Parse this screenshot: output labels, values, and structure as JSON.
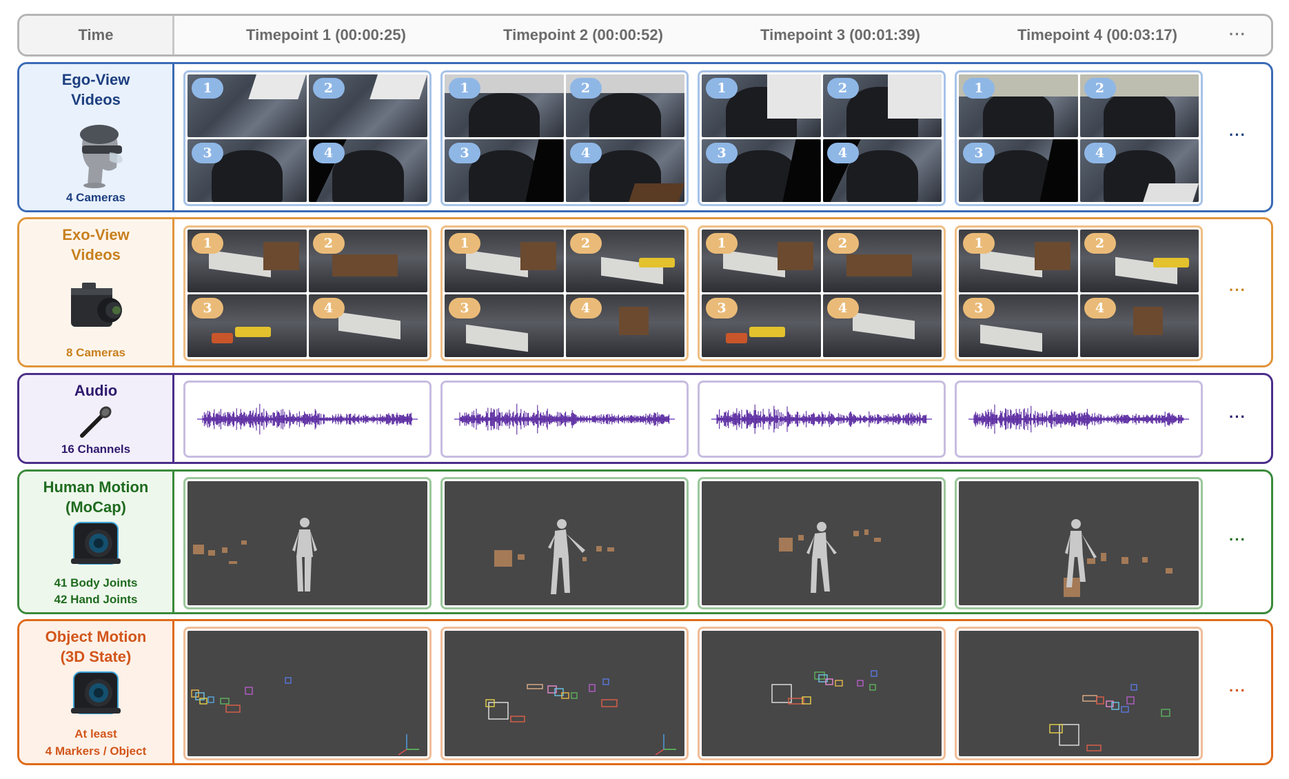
{
  "header": {
    "time_label": "Time",
    "timepoints": [
      "Timepoint 1 (00:00:25)",
      "Timepoint 2 (00:00:52)",
      "Timepoint 3 (00:01:39)",
      "Timepoint 4 (00:03:17)"
    ],
    "ellipsis": "···"
  },
  "rows": {
    "ego": {
      "title_line1": "Ego-View",
      "title_line2": "Videos",
      "sub": "4 Cameras",
      "icon": "vr-headset-icon",
      "color": "#1e3f80",
      "ellipsis": "···"
    },
    "exo": {
      "title_line1": "Exo-View",
      "title_line2": "Videos",
      "sub": "8 Cameras",
      "icon": "camera-icon",
      "color": "#c8801e",
      "ellipsis": "···"
    },
    "audio": {
      "title_line1": "Audio",
      "sub": "16 Channels",
      "icon": "microphone-icon",
      "color": "#2f1a6e",
      "ellipsis": "···"
    },
    "hmotion": {
      "title_line1": "Human Motion",
      "title_line2": "(MoCap)",
      "sub_line1": "41 Body Joints",
      "sub_line2": "42 Hand Joints",
      "icon": "mocap-camera-icon",
      "color": "#1f6b1f",
      "ellipsis": "···"
    },
    "omotion": {
      "title_line1": "Object Motion",
      "title_line2": "(3D State)",
      "sub_line1": "At least",
      "sub_line2": "4 Markers / Object",
      "icon": "mocap-camera-icon",
      "color": "#d2561a",
      "ellipsis": "···"
    }
  },
  "badges": [
    "1",
    "2",
    "3",
    "4"
  ]
}
